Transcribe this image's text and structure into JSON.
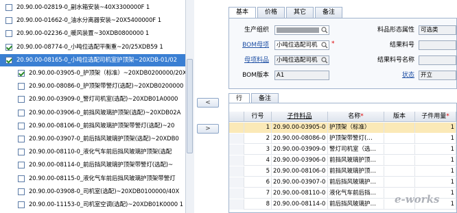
{
  "tree": {
    "items": [
      {
        "text": "20.90.00-02819-0_副水箱安装~40X3300000F 1",
        "checked": false,
        "indent": 0
      },
      {
        "text": "20.90.00-01662-0_油水分离器安装~20X5400000F 1",
        "checked": false,
        "indent": 0
      },
      {
        "text": "20.90.00-02236-0_暖风装置~30XDB0800000 1",
        "checked": false,
        "indent": 0
      },
      {
        "text": "20.90.00-08774-0_小吨位选配平衡重~20/25XDB59 1",
        "checked": true,
        "indent": 0
      },
      {
        "text": "20.90.00-08165-0_小吨位选配司机室护顶架~20XDB-01/02",
        "checked": true,
        "indent": 0,
        "selected": true
      },
      {
        "text": "20.90.00-03905-0_护顶架（标准）~20XDB0200000/20X",
        "checked": true,
        "indent": 1
      },
      {
        "text": "20.90.00-08086-0_护顶架带警灯(选配)~20XDB0200000",
        "checked": false,
        "indent": 1
      },
      {
        "text": "20.90.00-03909-0_警灯司机室(选配)~20XDB01A0000",
        "checked": false,
        "indent": 1
      },
      {
        "text": "20.90.00-03906-0_前挡风玻璃护顶架(选配)~20XDB02A",
        "checked": false,
        "indent": 1
      },
      {
        "text": "20.90.00-08106-0_前挡风玻璃护顶架带警灯(选配)~20",
        "checked": false,
        "indent": 1
      },
      {
        "text": "20.90.00-03907-0_前后挡风玻璃护顶架(选配)~20XDB0",
        "checked": false,
        "indent": 1
      },
      {
        "text": "20.90.00-08110-0_液化气车前后挡风玻璃护顶架(选配",
        "checked": false,
        "indent": 1
      },
      {
        "text": "20.90.00-08114-0_前后挡风玻璃护顶架带警灯(选配)~",
        "checked": false,
        "indent": 1
      },
      {
        "text": "20.90.00-08115-0_液化气车前后挡风玻璃护顶架带警灯",
        "checked": false,
        "indent": 1
      },
      {
        "text": "20.90.00-03908-0_司机室(选配)~20XDB0100000/40X",
        "checked": false,
        "indent": 1
      },
      {
        "text": "20.90.00-11153-0_司机室空调(选配)~20XDB01K0000 1",
        "checked": false,
        "indent": 1
      }
    ]
  },
  "buttons": {
    "left": "<",
    "right": ">"
  },
  "top_tabs": [
    "基本",
    "价格",
    "其它",
    "备注"
  ],
  "form": {
    "org_label": "生产组织",
    "org_value": "",
    "bom_parent_label": "BOM母项",
    "bom_parent_value": "小吨位选配司机",
    "parent_item_label": "母项料品",
    "parent_item_value": "小吨位选配司机",
    "bom_version_label": "BOM版本",
    "bom_version_value": "A1",
    "form_attr_label": "料品形态属性",
    "form_attr_value": "可选类",
    "end_code_label": "结果料号",
    "end_code_value": "",
    "end_name_label": "结果料号名称",
    "end_name_value": "",
    "status_label": "状态",
    "status_value": "开立"
  },
  "bottom_tabs": [
    "行",
    "备注"
  ],
  "grid": {
    "headers": [
      "行号",
      "子件料品",
      "名称",
      "版本",
      "子件用量"
    ],
    "rows": [
      {
        "no": "1",
        "code": "20.90.00-03905-0",
        "name": "护顶架（标准）",
        "ver": "",
        "qty": "1"
      },
      {
        "no": "2",
        "code": "20.90.00-08086-0",
        "name": "护顶架带警灯(…",
        "ver": "",
        "qty": "1"
      },
      {
        "no": "3",
        "code": "20.90.00-03909-0",
        "name": "警灯司机室（选…",
        "ver": "",
        "qty": "1"
      },
      {
        "no": "4",
        "code": "20.90.00-03906-0",
        "name": "前挡风玻璃护顶…",
        "ver": "",
        "qty": "1"
      },
      {
        "no": "5",
        "code": "20.90.00-08106-0",
        "name": "前挡风玻璃护顶…",
        "ver": "",
        "qty": "1"
      },
      {
        "no": "6",
        "code": "20.90.00-03907-0",
        "name": "前后挡风玻璃护…",
        "ver": "",
        "qty": "1"
      },
      {
        "no": "7",
        "code": "20.90.00-08110-0",
        "name": "液化气车前后挡…",
        "ver": "",
        "qty": "1"
      },
      {
        "no": "8",
        "code": "20.90.00-08114-0",
        "name": "前后挡风玻璃护…",
        "ver": "",
        "qty": "1"
      }
    ]
  },
  "watermark": "e-works"
}
